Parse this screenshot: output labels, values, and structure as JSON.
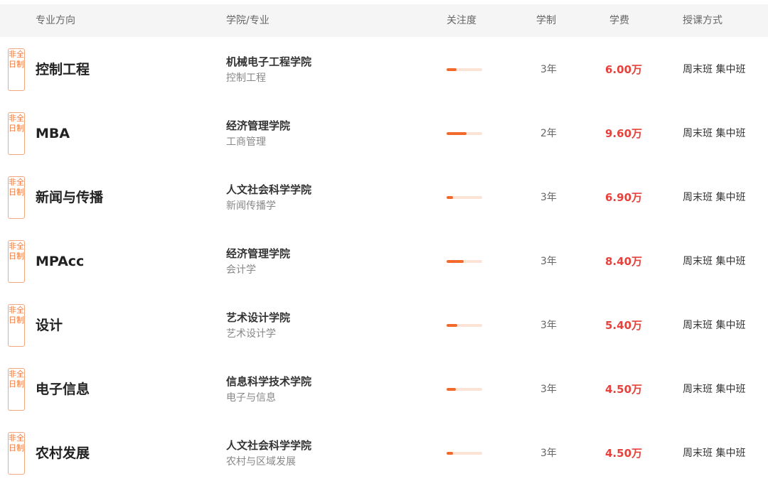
{
  "header": {
    "major": "专业方向",
    "college": "学院/专业",
    "attention": "关注度",
    "duration": "学制",
    "fee": "学费",
    "method": "授课方式"
  },
  "colors": {
    "accent": "#f26a2b",
    "fee": "#e8413b",
    "badge": "#ef7a3e"
  },
  "rows": [
    {
      "badge": "非全日制",
      "major": "控制工程",
      "college": "机械电子工程学院",
      "subject": "控制工程",
      "attention": 0.28,
      "duration": "3年",
      "fee": "6.00万",
      "method": "周末班 集中班"
    },
    {
      "badge": "非全日制",
      "major": "MBA",
      "college": "经济管理学院",
      "subject": "工商管理",
      "attention": 0.55,
      "duration": "2年",
      "fee": "9.60万",
      "method": "周末班 集中班"
    },
    {
      "badge": "非全日制",
      "major": "新闻与传播",
      "college": "人文社会科学学院",
      "subject": "新闻传播学",
      "attention": 0.18,
      "duration": "3年",
      "fee": "6.90万",
      "method": "周末班 集中班"
    },
    {
      "badge": "非全日制",
      "major": "MPAcc",
      "college": "经济管理学院",
      "subject": "会计学",
      "attention": 0.48,
      "duration": "3年",
      "fee": "8.40万",
      "method": "周末班 集中班"
    },
    {
      "badge": "非全日制",
      "major": "设计",
      "college": "艺术设计学院",
      "subject": "艺术设计学",
      "attention": 0.3,
      "duration": "3年",
      "fee": "5.40万",
      "method": "周末班 集中班"
    },
    {
      "badge": "非全日制",
      "major": "电子信息",
      "college": "信息科学技术学院",
      "subject": "电子与信息",
      "attention": 0.26,
      "duration": "3年",
      "fee": "4.50万",
      "method": "周末班 集中班"
    },
    {
      "badge": "非全日制",
      "major": "农村发展",
      "college": "人文社会科学学院",
      "subject": "农村与区域发展",
      "attention": 0.18,
      "duration": "3年",
      "fee": "4.50万",
      "method": "周末班 集中班"
    }
  ]
}
